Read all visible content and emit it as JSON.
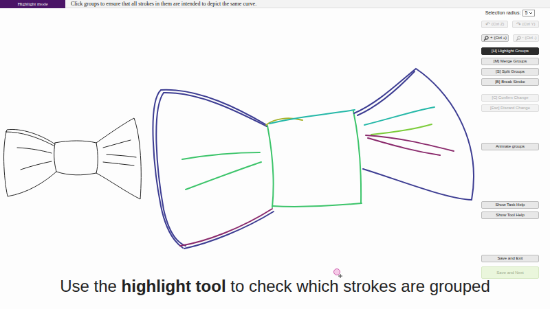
{
  "mode_badge": "Highlight mode",
  "instruction": "Click groups to ensure that all strokes in them are intended to depict the same curve.",
  "selection_radius": {
    "label": "Selection radius:",
    "value": "5"
  },
  "history": [
    {
      "icon": "↶",
      "label": "(Ctrl Z)",
      "disabled": true
    },
    {
      "icon": "↷",
      "label": "(Ctrl Y)",
      "disabled": true
    }
  ],
  "zoom": [
    {
      "icon": "+",
      "label": "(Ctrl +)",
      "disabled": false
    },
    {
      "icon": "-",
      "label": "(Ctrl -)",
      "disabled": true
    }
  ],
  "tools": [
    {
      "label": "[H] Highlight Groups",
      "selected": true
    },
    {
      "label": "[M] Merge Groups",
      "selected": false
    },
    {
      "label": "[S] Split Groups",
      "selected": false
    },
    {
      "label": "[B] Break Stroke",
      "selected": false
    }
  ],
  "change": [
    {
      "label": "[C] Confirm Change",
      "disabled": true
    },
    {
      "label": "[Esc] Discard Change",
      "disabled": true
    }
  ],
  "animate": "Animate groups",
  "help": [
    "Show Task Help",
    "Show Tool Help"
  ],
  "save": [
    {
      "label": "Save and Exit",
      "kind": "plain",
      "disabled": false
    },
    {
      "label": "Save and Next",
      "kind": "next",
      "disabled": true
    }
  ],
  "groups": [
    {
      "color": "#3c3c92"
    },
    {
      "color": "#3cc46a"
    },
    {
      "color": "#25b8a8"
    },
    {
      "color": "#a6b22a"
    },
    {
      "color": "#8a2a6c"
    },
    {
      "color": "#7ccc3a"
    }
  ],
  "caption": [
    {
      "text": "Use the ",
      "bold": false
    },
    {
      "text": "highlight tool",
      "bold": true
    },
    {
      "text": " to check which strokes are grouped",
      "bold": false
    }
  ]
}
